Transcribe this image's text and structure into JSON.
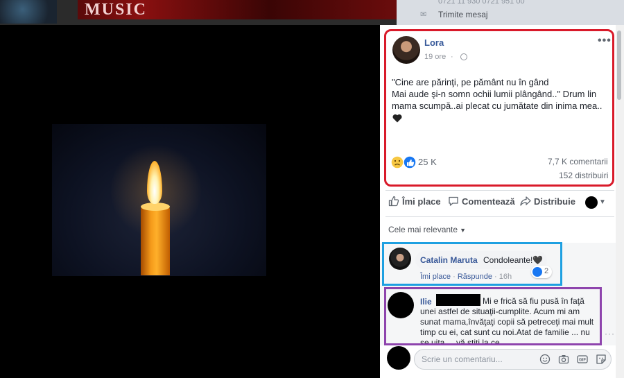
{
  "background": {
    "banner_text": "MUSIC",
    "contact_phone": "0721 11 930 0721 951 00",
    "send_message_label": "Trimite mesaj"
  },
  "post": {
    "author": "Lora",
    "time": "19 ore",
    "menu_label": "•••",
    "text": "\"Cine are părinţi, pe pământ nu în gând\nMai aude şi-n somn ochii lumii plângând..\" Drum lin mama scumpă..ai plecat cu jumătate din inima mea..",
    "reactions_count": "25 K",
    "comments_count": "7,7 K comentarii",
    "shares_count": "152 distribuiri"
  },
  "actions": {
    "like_label": "Îmi place",
    "comment_label": "Comentează",
    "share_label": "Distribuie"
  },
  "sort": {
    "label": "Cele mai relevante"
  },
  "comments": [
    {
      "author": "Catalin Maruta",
      "text": "Condoleante!🖤",
      "like_label": "Îmi place",
      "reply_label": "Răspunde",
      "time": "16h",
      "likes": "2"
    },
    {
      "author": "Ilie",
      "text": "Mi e frică să fiu pusă în faţă unei astfel de situaţii-cumplite. Acum mi am sunat mama,învăţaţi copii să petreceţi mai mult timp cu ei, cat sunt cu noi.Atat de familie ... nu se uita ... vă ştiţi la ce ..."
    }
  ],
  "comment_input": {
    "placeholder": "Scrie un comentariu..."
  },
  "colors": {
    "highlight_post": "#d91a2a",
    "highlight_comment_1": "#1ea0e1",
    "highlight_comment_2": "#8e44ad",
    "link_blue": "#385898"
  }
}
